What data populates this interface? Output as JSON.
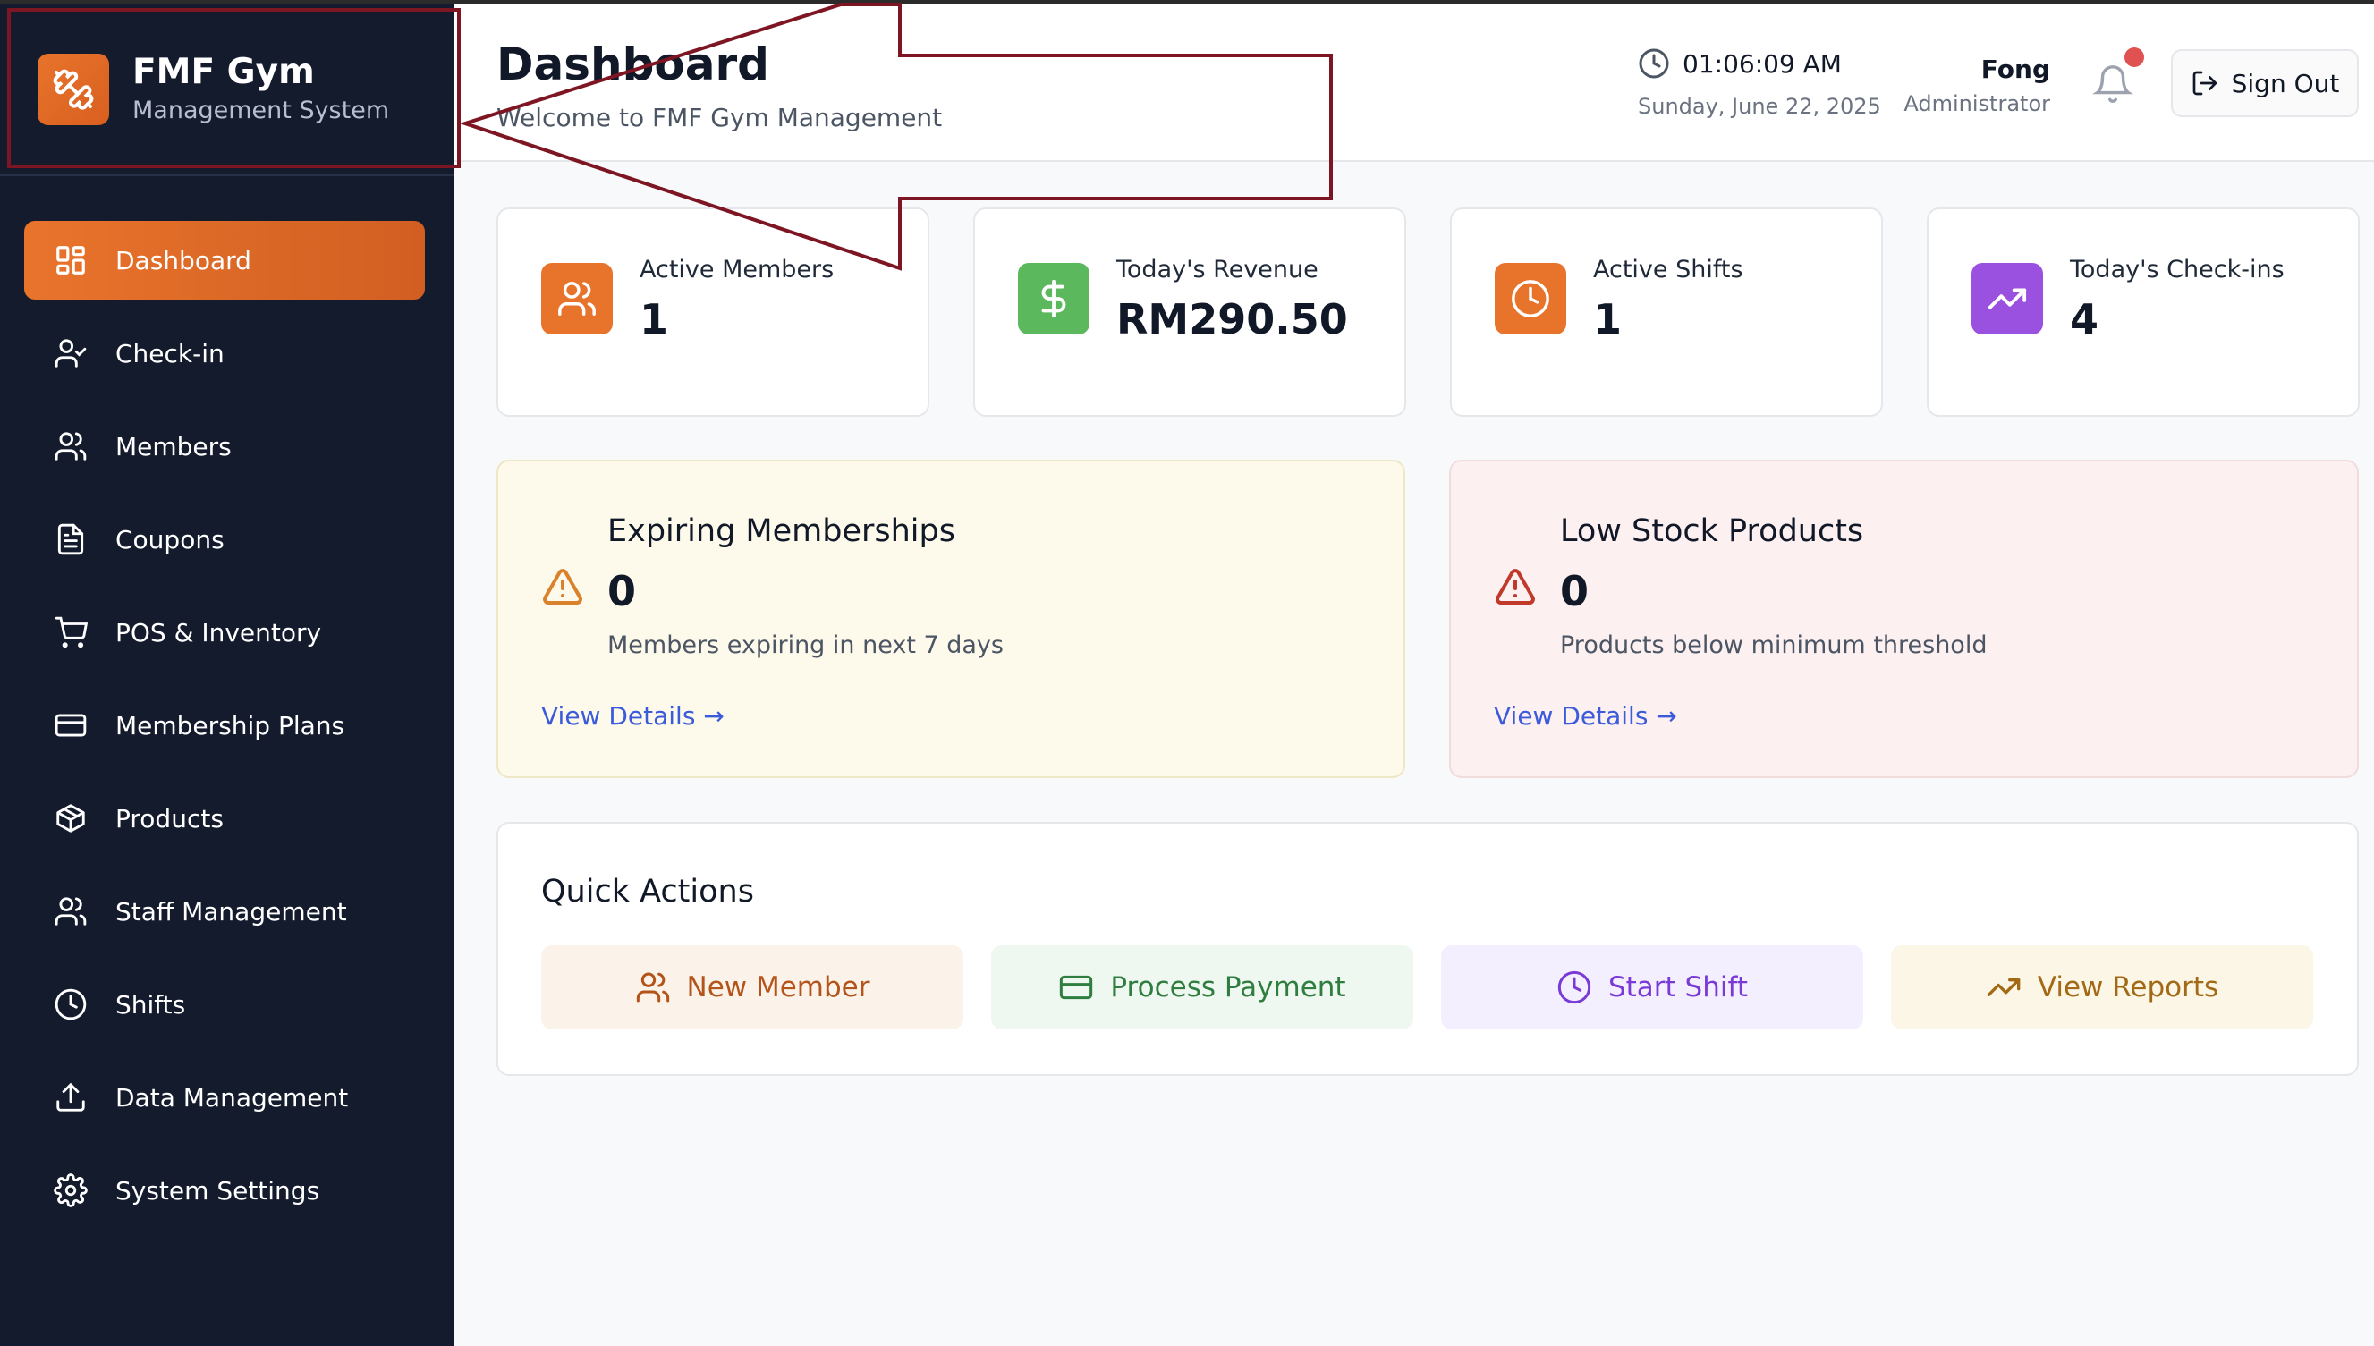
{
  "brand": {
    "name": "FMF Gym",
    "subtitle": "Management System"
  },
  "sidebar": {
    "items": [
      {
        "label": "Dashboard",
        "icon": "dashboard-icon",
        "active": true
      },
      {
        "label": "Check-in",
        "icon": "user-check-icon"
      },
      {
        "label": "Members",
        "icon": "users-icon"
      },
      {
        "label": "Coupons",
        "icon": "document-icon"
      },
      {
        "label": "POS & Inventory",
        "icon": "cart-icon"
      },
      {
        "label": "Membership Plans",
        "icon": "card-icon"
      },
      {
        "label": "Products",
        "icon": "package-icon"
      },
      {
        "label": "Staff Management",
        "icon": "users-icon"
      },
      {
        "label": "Shifts",
        "icon": "clock-icon"
      },
      {
        "label": "Data Management",
        "icon": "upload-icon"
      },
      {
        "label": "System Settings",
        "icon": "gear-icon"
      }
    ]
  },
  "header": {
    "title": "Dashboard",
    "subtitle": "Welcome to FMF Gym Management",
    "time": "01:06:09 AM",
    "date": "Sunday, June 22, 2025",
    "user_name": "Fong",
    "user_role": "Administrator",
    "signout_label": "Sign Out"
  },
  "stats": [
    {
      "label": "Active Members",
      "value": "1",
      "icon": "users-icon",
      "color": "#e8742c"
    },
    {
      "label": "Today's Revenue",
      "value": "RM290.50",
      "icon": "dollar-icon",
      "color": "#5cb85c"
    },
    {
      "label": "Active Shifts",
      "value": "1",
      "icon": "clock-icon",
      "color": "#e8742c"
    },
    {
      "label": "Today's Check-ins",
      "value": "4",
      "icon": "trending-up-icon",
      "color": "#9b51e0"
    }
  ],
  "alerts": [
    {
      "title": "Expiring Memberships",
      "count": "0",
      "description": "Members expiring in next 7 days",
      "link": "View Details →",
      "color": "#d9822b"
    },
    {
      "title": "Low Stock Products",
      "count": "0",
      "description": "Products below minimum threshold",
      "link": "View Details →",
      "color": "#c0392b"
    }
  ],
  "quick_actions": {
    "title": "Quick Actions",
    "buttons": [
      {
        "label": "New Member",
        "icon": "users-icon"
      },
      {
        "label": "Process Payment",
        "icon": "card-icon"
      },
      {
        "label": "Start Shift",
        "icon": "clock-icon"
      },
      {
        "label": "View Reports",
        "icon": "trending-up-icon"
      }
    ]
  },
  "colors": {
    "sidebar_bg": "#141b2d",
    "accent": "#e8742c",
    "link": "#3b5bdb",
    "annotation": "#7d1522"
  }
}
